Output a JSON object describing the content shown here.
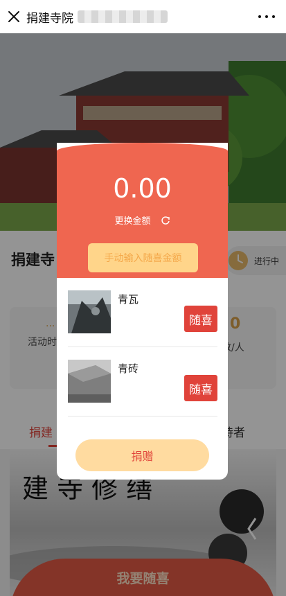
{
  "topbar": {
    "title": "捐建寺院"
  },
  "page": {
    "project_title": "捐建寺",
    "status": "进行中",
    "stat_left_value": "...",
    "stat_left_label": "活动时",
    "stat_right_value": "0",
    "stat_right_label": "人数/人",
    "tab_left": "捐建",
    "tab_right": "持者",
    "poster_text": "建 寺 修 缮",
    "cta": "我要随喜"
  },
  "modal": {
    "amount": "0.00",
    "change_label": "更换金额",
    "manual_input": "手动输入随喜金额",
    "items": [
      {
        "name": "青瓦",
        "button": "随喜"
      },
      {
        "name": "青砖",
        "button": "随喜"
      }
    ],
    "submit": "捐赠"
  },
  "colors": {
    "modal_header": "#ef6650",
    "accent_red": "#e0433a",
    "manual_button": "#ffd58a",
    "submit_button": "#ffdba0",
    "gold": "#d7a14a"
  }
}
